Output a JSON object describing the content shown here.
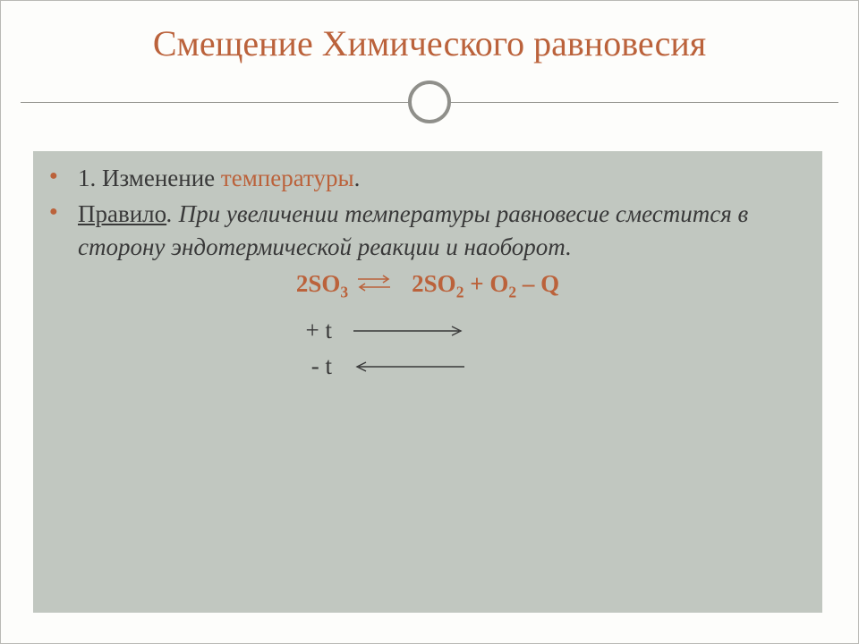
{
  "title": "Смещение Химического равновесия",
  "bullets": {
    "b1_prefix": "1. Изменение ",
    "b1_highlight": "температуры",
    "b1_suffix": ".",
    "b2_rule": "Правило",
    "b2_text": ". При увеличении температуры равновесие сместится в сторону эндотермической реакции и наоборот."
  },
  "equation": {
    "lhs_coef": "2SO",
    "lhs_sub": "3",
    "rhs_a": "2SO",
    "rhs_a_sub": "2",
    "plus": " + O",
    "rhs_b_sub": "2",
    "tail": " – Q"
  },
  "temps": {
    "plus": "+ t",
    "minus": "- t"
  }
}
